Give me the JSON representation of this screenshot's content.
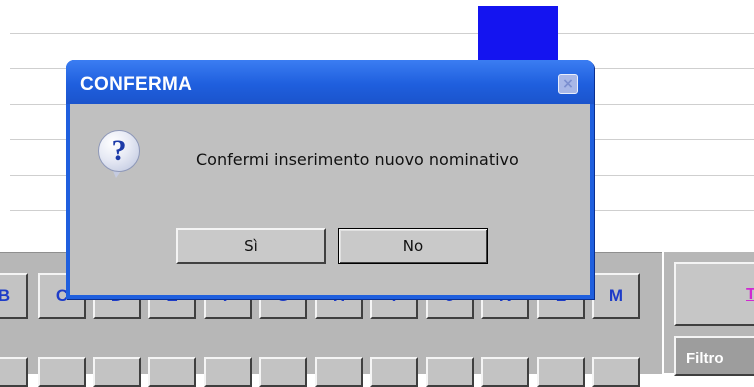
{
  "dialog": {
    "title": "CONFERMA",
    "message": "Confermi inserimento nuovo nominativo",
    "yes_label": "Sì",
    "no_label": "No",
    "close_icon": "×",
    "question_icon": "?"
  },
  "keyboard": {
    "row1": [
      "B",
      "C",
      "D",
      "E",
      "F",
      "G",
      "H",
      "I",
      "J",
      "K",
      "L",
      "M"
    ]
  },
  "side": {
    "button1_label": "T",
    "button2_label": "Filtro"
  },
  "colors": {
    "dialog_title_bar": "#1f5fde",
    "key_letter": "#1e3cc8",
    "side_button_text": "#d02ad0"
  }
}
